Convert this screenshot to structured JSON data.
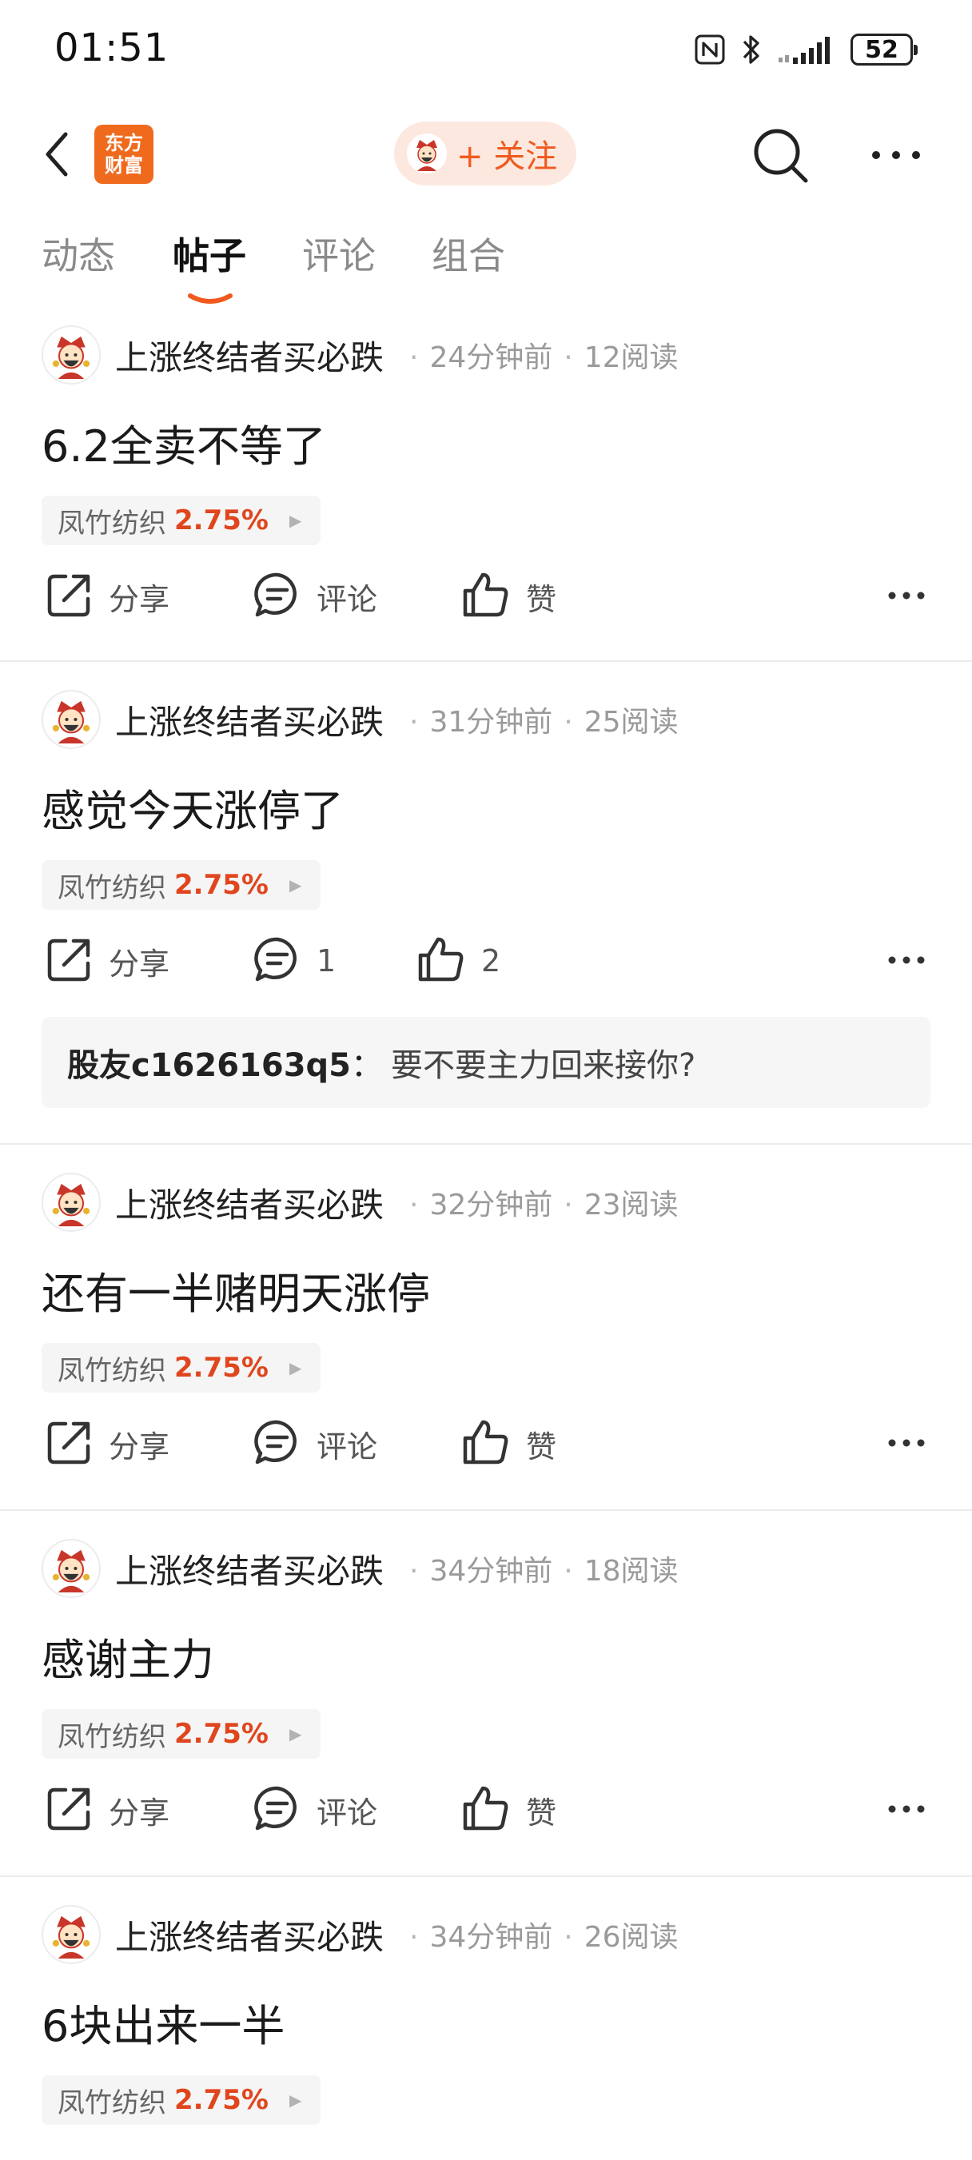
{
  "status_bar": {
    "time": "01:51",
    "battery": "52",
    "icons": [
      "nfc-icon",
      "bluetooth-icon",
      "signal-icon",
      "battery-icon"
    ]
  },
  "header": {
    "logo_line1": "东方",
    "logo_line2": "财富",
    "follow_label": "+ 关注",
    "accent_color": "#f05a1e",
    "icons": [
      "back-arrow-icon",
      "search-icon",
      "more-icon"
    ]
  },
  "tabs": [
    {
      "label": "动态",
      "active": false
    },
    {
      "label": "帖子",
      "active": true
    },
    {
      "label": "评论",
      "active": false
    },
    {
      "label": "组合",
      "active": false
    }
  ],
  "posts": [
    {
      "author": "上涨终结者买必跌",
      "time": "24分钟前",
      "reads": "12阅读",
      "title": "6.2全卖不等了",
      "stock": "凤竹纺织",
      "change": "2.75%",
      "share_label": "分享",
      "comment_label": "评论",
      "like_label": "赞"
    },
    {
      "author": "上涨终结者买必跌",
      "time": "31分钟前",
      "reads": "25阅读",
      "title": "感觉今天涨停了",
      "stock": "凤竹纺织",
      "change": "2.75%",
      "share_label": "分享",
      "comment_label": "1",
      "like_label": "2",
      "reply": {
        "user": "股友c1626163q5",
        "separator": "：",
        "text": "要不要主力回来接你?"
      }
    },
    {
      "author": "上涨终结者买必跌",
      "time": "32分钟前",
      "reads": "23阅读",
      "title": "还有一半赌明天涨停",
      "stock": "凤竹纺织",
      "change": "2.75%",
      "share_label": "分享",
      "comment_label": "评论",
      "like_label": "赞"
    },
    {
      "author": "上涨终结者买必跌",
      "time": "34分钟前",
      "reads": "18阅读",
      "title": "感谢主力",
      "stock": "凤竹纺织",
      "change": "2.75%",
      "share_label": "分享",
      "comment_label": "评论",
      "like_label": "赞"
    },
    {
      "author": "上涨终结者买必跌",
      "time": "34分钟前",
      "reads": "26阅读",
      "title": "6块出来一半",
      "stock": "凤竹纺织",
      "change": "2.75%"
    }
  ]
}
